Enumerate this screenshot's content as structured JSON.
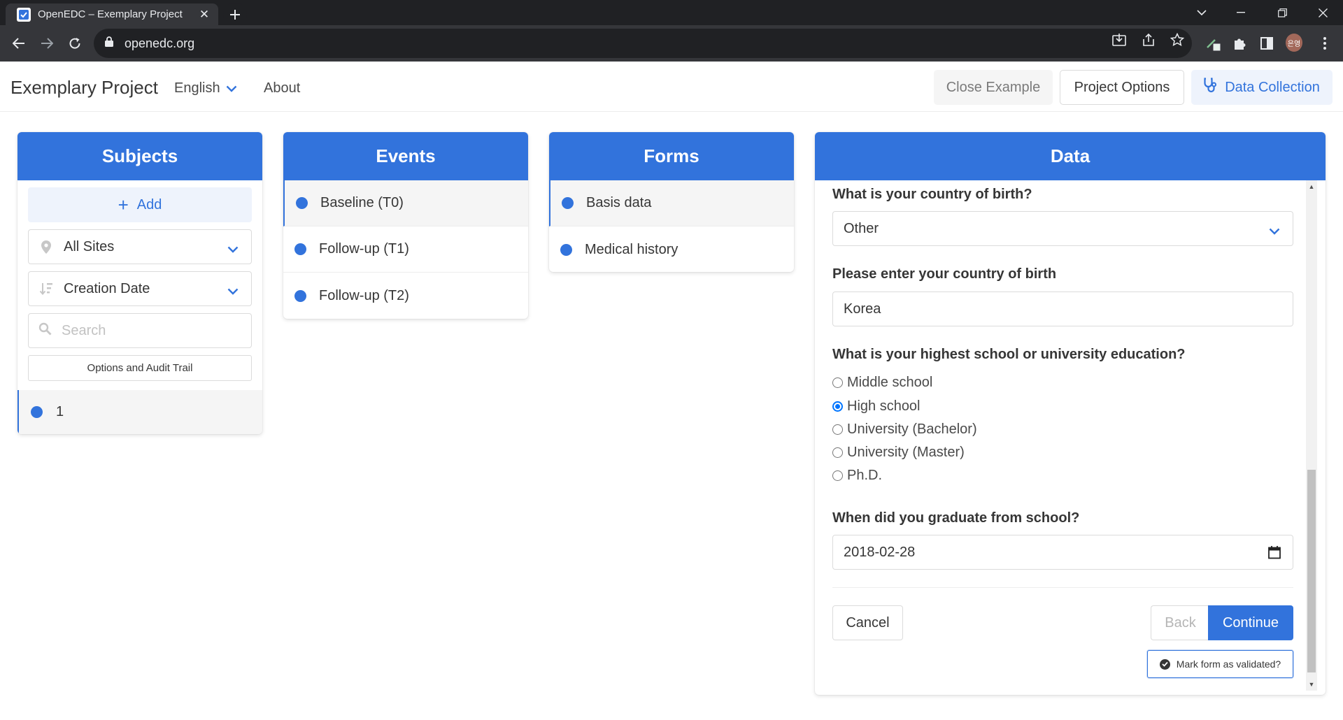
{
  "browser": {
    "tab_title": "OpenEDC – Exemplary Project",
    "url": "openedc.org",
    "profile_initials": "은영"
  },
  "header": {
    "project_title": "Exemplary Project",
    "language": "English",
    "about": "About",
    "close_example": "Close Example",
    "project_options": "Project Options",
    "data_collection": "Data Collection"
  },
  "subjects": {
    "title": "Subjects",
    "add_label": "Add",
    "site_filter": "All Sites",
    "sort_by": "Creation Date",
    "search_placeholder": "Search",
    "options_audit": "Options and Audit Trail",
    "items": [
      {
        "label": "1"
      }
    ]
  },
  "events": {
    "title": "Events",
    "items": [
      {
        "label": "Baseline (T0)"
      },
      {
        "label": "Follow-up (T1)"
      },
      {
        "label": "Follow-up (T2)"
      }
    ]
  },
  "forms": {
    "title": "Forms",
    "items": [
      {
        "label": "Basis data"
      },
      {
        "label": "Medical history"
      }
    ]
  },
  "data": {
    "title": "Data",
    "q_country": "What is your country of birth?",
    "country_value": "Other",
    "q_country_other": "Please enter your country of birth",
    "country_other_value": "Korea",
    "q_education": "What is your highest school or university education?",
    "education_options": [
      {
        "label": "Middle school",
        "checked": false
      },
      {
        "label": "High school",
        "checked": true
      },
      {
        "label": "University (Bachelor)",
        "checked": false
      },
      {
        "label": "University (Master)",
        "checked": false
      },
      {
        "label": "Ph.D.",
        "checked": false
      }
    ],
    "q_graduation": "When did you graduate from school?",
    "graduation_value": "2018-02-28",
    "cancel": "Cancel",
    "back": "Back",
    "continue": "Continue",
    "mark_validated": "Mark form as validated?"
  },
  "colors": {
    "primary": "#3273dc",
    "primary_light": "#eef3fc",
    "chrome_dark": "#202124",
    "chrome_toolbar": "#35363a"
  }
}
